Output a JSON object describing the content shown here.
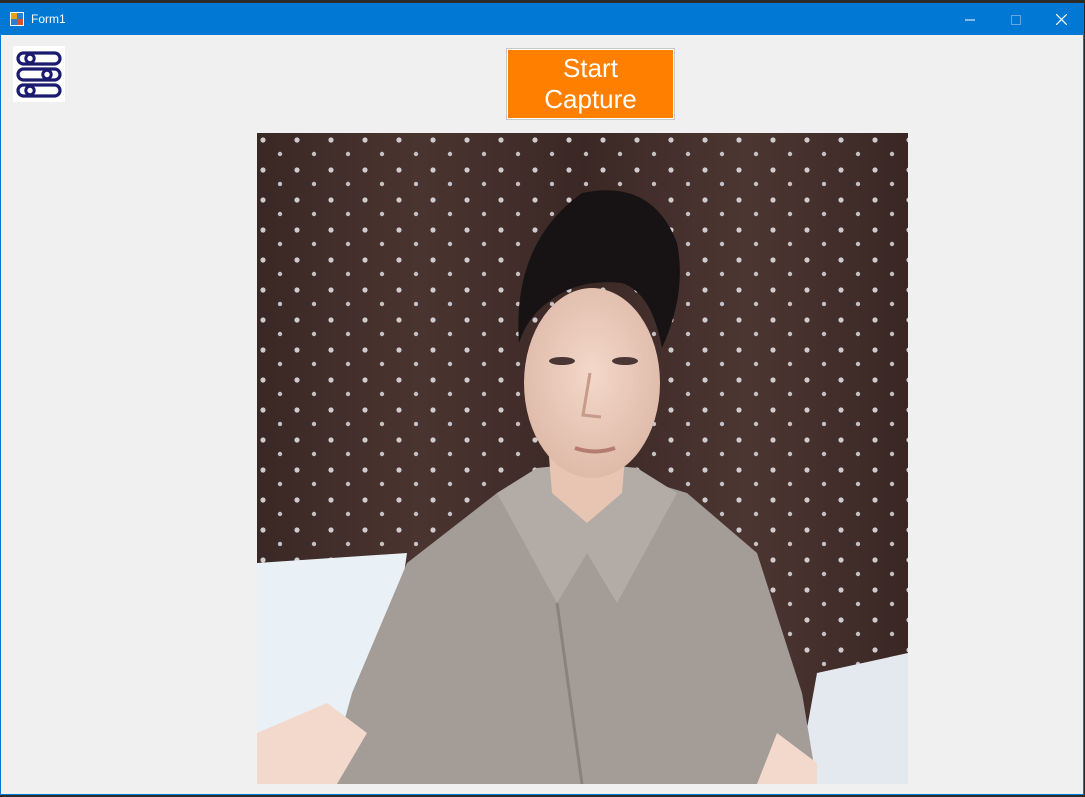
{
  "window": {
    "title": "Form1",
    "controls": {
      "minimize_icon": "minimize-icon",
      "maximize_icon": "maximize-icon",
      "close_icon": "close-icon"
    }
  },
  "toolbar": {
    "settings_icon": "sliders-icon",
    "capture_label": "Start Capture"
  },
  "camera": {
    "feed": "webcam-preview"
  },
  "colors": {
    "titlebar": "#0078d4",
    "window_bg": "#f0f0f0",
    "capture_button": "#ff7f00",
    "settings_icon": "#1a1a6e"
  }
}
